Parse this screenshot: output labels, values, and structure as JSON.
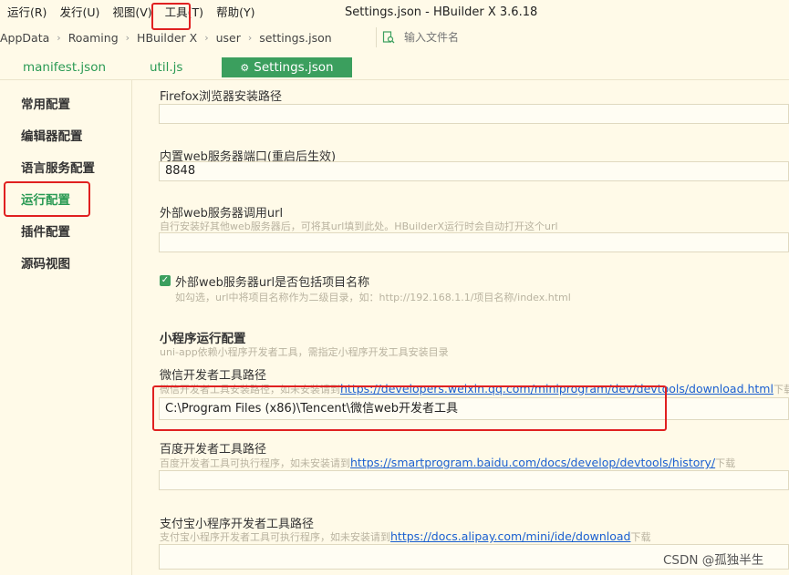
{
  "menu": {
    "items": [
      "运行(R)",
      "发行(U)",
      "视图(V)",
      "工具(T)",
      "帮助(Y)"
    ],
    "window_title": "Settings.json - HBuilder X 3.6.18"
  },
  "breadcrumb": [
    "AppData",
    "Roaming",
    "HBuilder X",
    "user",
    "settings.json"
  ],
  "file_search": {
    "placeholder": "输入文件名",
    "icon": "file-search-icon"
  },
  "tabs": {
    "items": [
      "manifest.json",
      "util.js"
    ],
    "active": "Settings.json",
    "active_icon": "gear-icon"
  },
  "sidebar": {
    "items": [
      "常用配置",
      "编辑器配置",
      "语言服务配置",
      "运行配置",
      "插件配置",
      "源码视图"
    ],
    "active_index": 3
  },
  "settings": {
    "firefox": {
      "label": "Firefox浏览器安装路径",
      "value": ""
    },
    "web_port": {
      "label": "内置web服务器端口(重启后生效)",
      "value": "8848"
    },
    "external_url": {
      "label": "外部web服务器调用url",
      "hint": "自行安装好其他web服务器后，可将其url填到此处。HBuilderX运行时会自动打开这个url",
      "value": ""
    },
    "include_project": {
      "checked": true,
      "label": "外部web服务器url是否包括项目名称",
      "hint": "如勾选，url中将项目名称作为二级目录，如：http://192.168.1.1/项目名称/index.html"
    },
    "mini_program": {
      "title": "小程序运行配置",
      "hint": "uni-app依赖小程序开发者工具，需指定小程序开发工具安装目录"
    },
    "wechat": {
      "label": "微信开发者工具路径",
      "hint_prefix": "微信开发者工具安装路径，如未安装请到",
      "link": "https://developers.weixin.qq.com/miniprogram/dev/devtools/download.html",
      "hint_suffix": "下载",
      "value": "C:\\Program Files (x86)\\Tencent\\微信web开发者工具"
    },
    "baidu": {
      "label": "百度开发者工具路径",
      "hint_prefix": "百度开发者工具可执行程序，如未安装请到",
      "link": "https://smartprogram.baidu.com/docs/develop/devtools/history/",
      "hint_suffix": "下载",
      "value": ""
    },
    "alipay": {
      "label": "支付宝小程序开发者工具路径",
      "hint_prefix": "支付宝小程序开发者工具可执行程序，如未安装请到",
      "link": "https://docs.alipay.com/mini/ide/download",
      "hint_suffix": "下载",
      "value": ""
    }
  },
  "watermark": "CSDN @孤独半生",
  "colors": {
    "accent": "#3b9f5e",
    "highlight": "#e02020",
    "link": "#1a5fd0",
    "background": "#fffae8"
  }
}
